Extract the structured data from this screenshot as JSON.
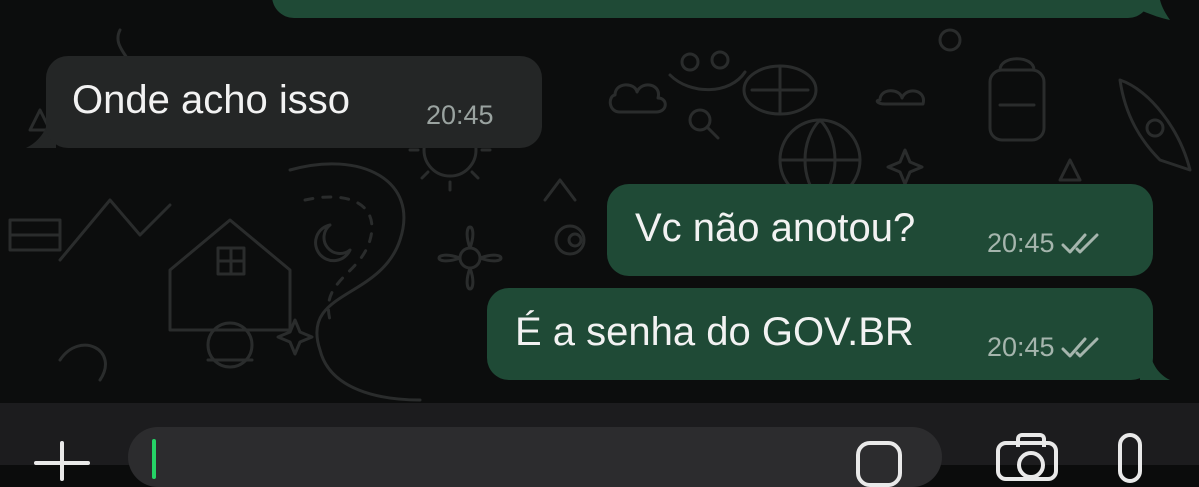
{
  "messages": [
    {
      "direction": "outgoing",
      "text": "",
      "time": ""
    },
    {
      "direction": "incoming",
      "text": "Onde acho isso",
      "time": "20:45"
    },
    {
      "direction": "outgoing",
      "text": "Vc não anotou?",
      "time": "20:45",
      "status": "read-double-check-icon"
    },
    {
      "direction": "outgoing",
      "text": "É a senha do GOV.BR",
      "time": "20:45",
      "status": "read-double-check-icon"
    }
  ],
  "composer": {
    "placeholder": "",
    "value": ""
  },
  "colors": {
    "background": "#0c0d0d",
    "incoming_bubble": "#242626",
    "outgoing_bubble": "#1f4a36",
    "cursor": "#25d366"
  },
  "icons": [
    "plus-icon",
    "sticker-icon",
    "camera-icon",
    "microphone-icon",
    "double-check-icon"
  ]
}
